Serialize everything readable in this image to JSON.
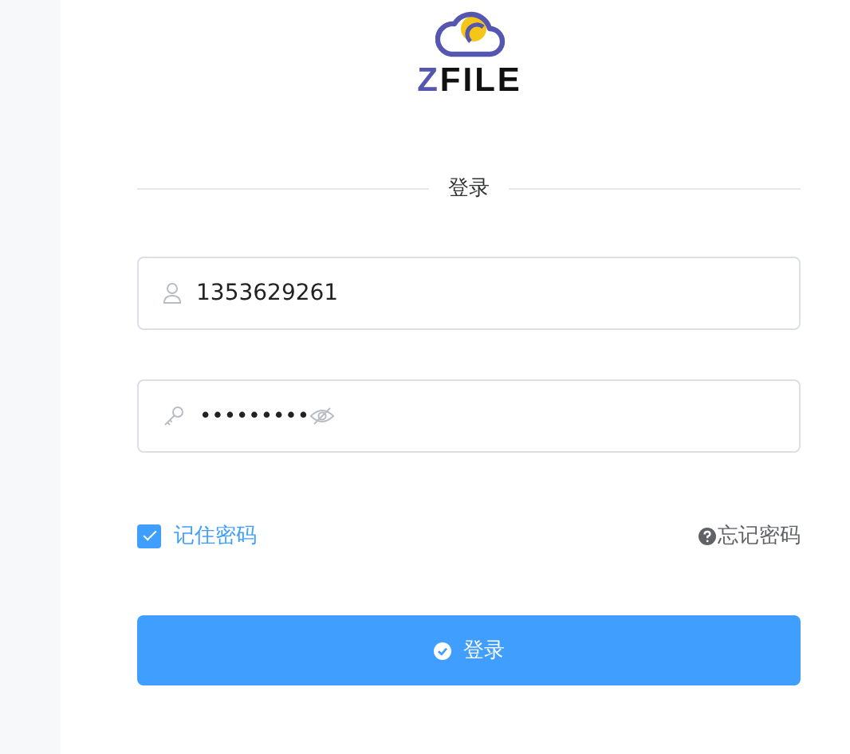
{
  "logo": {
    "accent": "Z",
    "rest": "FILE"
  },
  "heading": "登录",
  "username": {
    "value": "1353629261"
  },
  "password": {
    "value": "•••••••••"
  },
  "remember": {
    "label": "记住密码",
    "checked": true
  },
  "forgot": {
    "label": "忘记密码"
  },
  "submit": {
    "label": "登录"
  }
}
